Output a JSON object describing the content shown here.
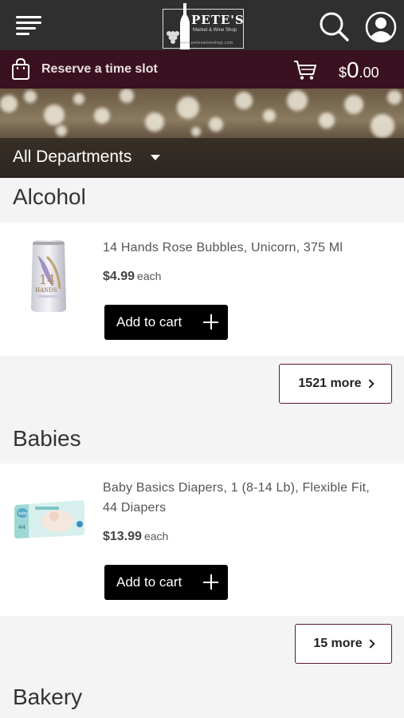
{
  "header": {
    "logo": {
      "name": "PETE'S",
      "tagline": "Market & Wine Shop",
      "url": "www.peteswineshop.com"
    },
    "icons": {
      "menu": "menu-icon",
      "search": "search-icon",
      "account": "account-icon"
    }
  },
  "slotbar": {
    "reserve_label": "Reserve a time slot",
    "cart": {
      "currency": "$",
      "dollars": "0",
      "cents": ".00"
    }
  },
  "departments": {
    "selected": "All Departments"
  },
  "sections": [
    {
      "title": "Alcohol",
      "product": {
        "name": "14 Hands Rose Bubbles, Unicorn, 375 Ml",
        "price": "$4.99",
        "unit": "each",
        "add_label": "Add to cart"
      },
      "more_label": "1521 more"
    },
    {
      "title": "Babies",
      "product": {
        "name": "Baby Basics Diapers, 1 (8-14 Lb), Flexible Fit, 44 Diapers",
        "price": "$13.99",
        "unit": "each",
        "add_label": "Add to cart"
      },
      "more_label": "15 more"
    },
    {
      "title": "Bakery"
    }
  ],
  "colors": {
    "topbar": "#2f2f2f",
    "slotbar": "#3a1120",
    "accent": "#5a1a2f",
    "button": "#000000"
  }
}
